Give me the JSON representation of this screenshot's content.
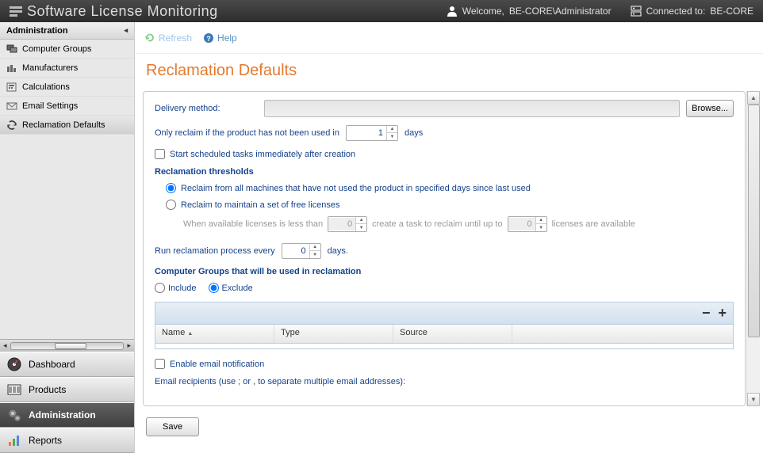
{
  "header": {
    "brand": "Software License Monitoring",
    "welcome_label": "Welcome,",
    "welcome_user": "BE-CORE\\Administrator",
    "connected_label": "Connected to:",
    "connected_value": "BE-CORE"
  },
  "sidebar": {
    "section_title": "Administration",
    "items": [
      {
        "label": "Computer Groups"
      },
      {
        "label": "Manufacturers"
      },
      {
        "label": "Calculations"
      },
      {
        "label": "Email Settings"
      },
      {
        "label": "Reclamation Defaults"
      }
    ]
  },
  "nav": {
    "dashboard": "Dashboard",
    "products": "Products",
    "administration": "Administration",
    "reports": "Reports"
  },
  "toolbar": {
    "refresh": "Refresh",
    "help": "Help"
  },
  "page": {
    "title": "Reclamation Defaults",
    "delivery_label": "Delivery method:",
    "delivery_value": "",
    "browse_label": "Browse...",
    "only_reclaim_prefix": "Only reclaim if the product has not been used in",
    "only_reclaim_value": "1",
    "only_reclaim_suffix": "days",
    "start_scheduled": "Start scheduled tasks immediately after creation",
    "thresholds_title": "Reclamation thresholds",
    "radio_all": "Reclaim from all machines that have not used the product in specified days since last used",
    "radio_free": "Reclaim to maintain a set of free licenses",
    "when_prefix": "When available licenses is less than",
    "when_v1": "0",
    "when_mid": "create a task to reclaim until up to",
    "when_v2": "0",
    "when_suffix": "licenses are available",
    "run_prefix": "Run reclamation process every",
    "run_value": "0",
    "run_suffix": "days.",
    "groups_title": "Computer Groups that will be used in reclamation",
    "include": "Include",
    "exclude": "Exclude",
    "grid_cols": {
      "name": "Name",
      "type": "Type",
      "source": "Source"
    },
    "enable_email": "Enable email notification",
    "email_recipients_label": "Email recipients (use ; or , to separate multiple email addresses):",
    "save_label": "Save"
  }
}
